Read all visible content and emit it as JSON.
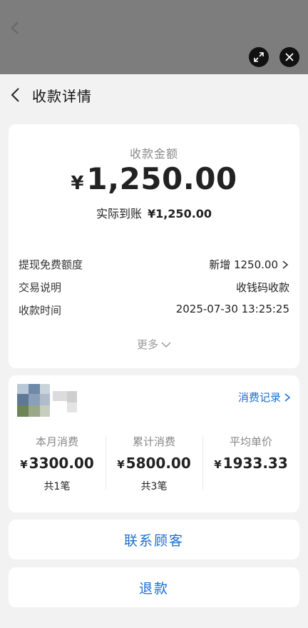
{
  "header": {
    "title": "收款详情"
  },
  "amount": {
    "label": "收款金额",
    "currency": "¥",
    "value": "1,250.00",
    "received_label": "实际到账",
    "received_value": "¥1,250.00"
  },
  "details": [
    {
      "label": "提现免费额度",
      "value": "新增 1250.00"
    },
    {
      "label": "交易说明",
      "value": "收钱码收款"
    },
    {
      "label": "收款时间",
      "value": "2025-07-30 13:25:25"
    }
  ],
  "more_label": "更多",
  "customer": {
    "records_label": "消费记录",
    "stats": [
      {
        "label": "本月消费",
        "currency": "¥",
        "value": "3300.00",
        "count": "共1笔"
      },
      {
        "label": "累计消费",
        "currency": "¥",
        "value": "5800.00",
        "count": "共3笔"
      },
      {
        "label": "平均单价",
        "currency": "¥",
        "value": "1933.33",
        "count": ""
      }
    ]
  },
  "actions": {
    "contact": "联系顾客",
    "refund": "退款"
  },
  "colors": {
    "accent": "#1a6fd1",
    "overlay": "#7d7d7d"
  }
}
